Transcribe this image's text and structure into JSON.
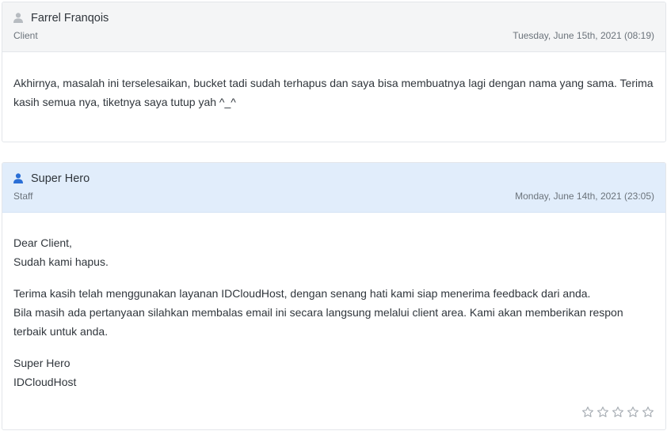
{
  "replies": [
    {
      "author": "Farrel Franqois",
      "role": "Client",
      "date": "Tuesday, June 15th, 2021 (08:19)",
      "message": "Akhirnya, masalah ini terselesaikan, bucket tadi sudah terhapus dan saya bisa membuatnya lagi dengan nama yang sama. Terima kasih semua nya, tiketnya saya tutup yah ^_^",
      "icon": "user-icon",
      "icon_color": "#b7bcc1"
    },
    {
      "author": "Super Hero",
      "role": "Staff",
      "date": "Monday, June 14th, 2021 (23:05)",
      "greeting": "Dear Client,",
      "line1": "Sudah kami hapus.",
      "line2": "Terima kasih telah menggunakan layanan IDCloudHost, dengan senang hati kami siap menerima feedback dari anda.",
      "line3": "Bila masih ada pertanyaan silahkan membalas email ini secara langsung melalui client area. Kami akan memberikan respon terbaik untuk anda.",
      "signature_name": "Super Hero",
      "signature_company": "IDCloudHost",
      "icon": "user-icon",
      "icon_color": "#2b6fd6",
      "rating": {
        "value": 0,
        "max": 5,
        "icon": "star-outline-icon"
      }
    }
  ]
}
